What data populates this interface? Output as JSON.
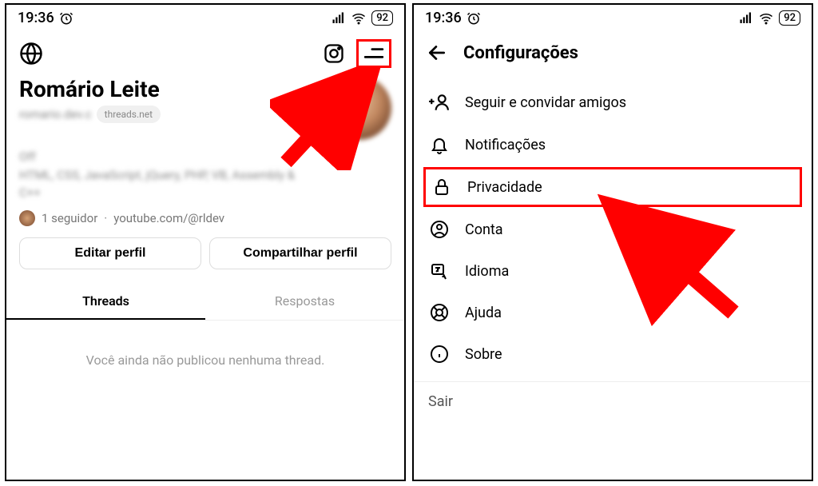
{
  "status": {
    "time": "19:36",
    "battery": "92"
  },
  "profile": {
    "name": "Romário Leite",
    "username": "romario.dev.c",
    "domain_badge": "threads.net",
    "bio_line1": "Off",
    "bio_line2": "HTML, CSS, JavaScript, jQuery, PHP, VB, Assembly &",
    "bio_line3": "C++",
    "followers": "1 seguidor",
    "link": "youtube.com/@rldev",
    "edit_btn": "Editar perfil",
    "share_btn": "Compartilhar perfil",
    "tab_threads": "Threads",
    "tab_replies": "Respostas",
    "empty": "Você ainda não publicou nenhuma thread."
  },
  "settings": {
    "title": "Configurações",
    "items": {
      "follow": "Seguir e convidar amigos",
      "notifications": "Notificações",
      "privacy": "Privacidade",
      "account": "Conta",
      "language": "Idioma",
      "help": "Ajuda",
      "about": "Sobre"
    },
    "logout": "Sair"
  }
}
